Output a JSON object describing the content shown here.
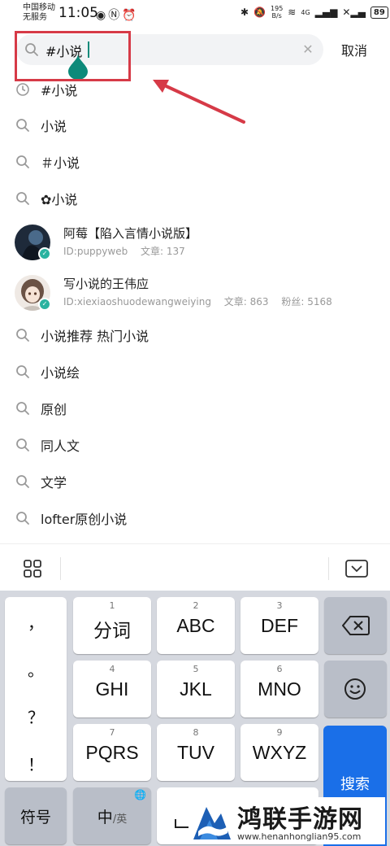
{
  "status_bar": {
    "carrier_line1": "中国移动",
    "carrier_line2": "无服务",
    "time": "11:05",
    "net_speed_value": "195",
    "net_speed_unit": "B/s",
    "network": "4G",
    "battery": "89"
  },
  "search": {
    "value": "#小说",
    "cancel_label": "取消",
    "accent_color": "#0d8a7a"
  },
  "suggestions": [
    {
      "text": "#小说",
      "icon": "history-icon"
    },
    {
      "text": "小说",
      "icon": "search-icon"
    },
    {
      "text": "＃小说",
      "icon": "search-icon"
    }
  ],
  "suggestions_after_one": [
    {
      "text": "✿小说",
      "icon": "search-icon"
    }
  ],
  "users": [
    {
      "name": "阿莓【陷入言情小说版】",
      "id": "ID:puppyweb",
      "articles": "文章: 137",
      "fans": ""
    },
    {
      "name": "写小说的王伟应",
      "id": "ID:xiexiaoshuodewangweiying",
      "articles": "文章: 863",
      "fans": "粉丝: 5168"
    }
  ],
  "suggestions_tail": [
    {
      "text": "小说推荐 热门小说"
    },
    {
      "text": "小说绘"
    },
    {
      "text": "原创"
    },
    {
      "text": "同人文"
    },
    {
      "text": "文学"
    },
    {
      "text": "lofter原创小说"
    }
  ],
  "keyboard": {
    "punct": [
      "，",
      "。",
      "？",
      "！"
    ],
    "keys": [
      {
        "num": "1",
        "label": "分词"
      },
      {
        "num": "2",
        "label": "ABC"
      },
      {
        "num": "3",
        "label": "DEF"
      },
      {
        "num": "4",
        "label": "GHI"
      },
      {
        "num": "5",
        "label": "JKL"
      },
      {
        "num": "6",
        "label": "MNO"
      },
      {
        "num": "7",
        "label": "PQRS"
      },
      {
        "num": "8",
        "label": "TUV"
      },
      {
        "num": "9",
        "label": "WXYZ"
      }
    ],
    "symbol_key": "符号",
    "lang_key_main": "中",
    "lang_key_sub": "/英",
    "search_key": "搜索",
    "search_key_color": "#1a6fe8"
  },
  "annotation": {
    "color": "#d63a47"
  },
  "watermark": {
    "title": "鸿联手游网",
    "url": "www.henanhonglian95.com"
  }
}
